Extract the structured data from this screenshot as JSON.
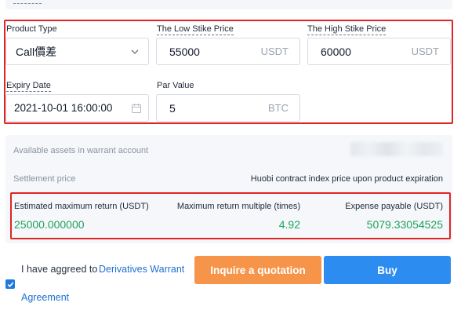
{
  "form": {
    "product_type": {
      "label": "Product Type",
      "value": "Call價差"
    },
    "low_strike": {
      "label": "The Low Stike Price",
      "value": "55000",
      "unit": "USDT"
    },
    "high_strike": {
      "label": "The High Stike Price",
      "value": "60000",
      "unit": "USDT"
    },
    "expiry": {
      "label": "Expiry Date",
      "value": "2021-10-01 16:00:00"
    },
    "par_value": {
      "label": "Par Value",
      "value": "5",
      "unit": "BTC"
    }
  },
  "info": {
    "available_label": "Available assets in warrant account",
    "settlement_label": "Settlement price",
    "settlement_value": "Huobi contract index price upon product expiration"
  },
  "returns": {
    "max_return_label": "Estimated maximum return (USDT)",
    "max_return_value": "25000.000000",
    "multiple_label": "Maximum return multiple (times)",
    "multiple_value": "4.92",
    "expense_label": "Expense payable (USDT)",
    "expense_value": "5079.33054525"
  },
  "agreement": {
    "checked": true,
    "prefix": "I have aggreed to",
    "link_line1": "Derivatives Warrant",
    "link_line2": "Agreement"
  },
  "actions": {
    "quote_label": "Inquire a quotation",
    "buy_label": "Buy"
  },
  "colors": {
    "highlight_border": "#e02424",
    "positive_value": "#1fa35c",
    "quote_button": "#f6954a",
    "buy_button": "#2d8cf0",
    "link": "#1f6fd1"
  }
}
